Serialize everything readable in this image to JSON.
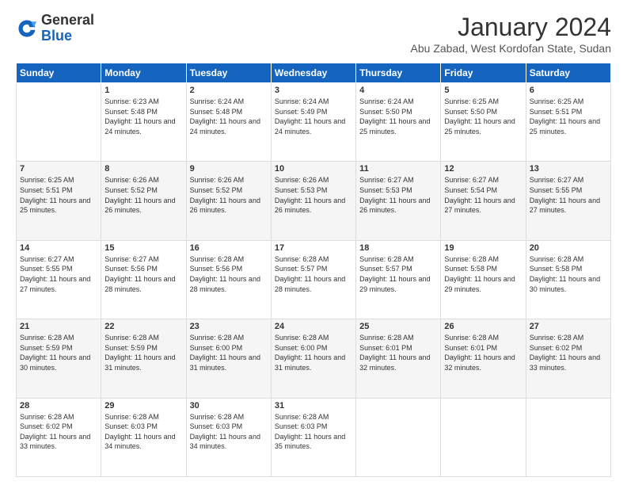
{
  "logo": {
    "general": "General",
    "blue": "Blue"
  },
  "header": {
    "month": "January 2024",
    "location": "Abu Zabad, West Kordofan State, Sudan"
  },
  "weekdays": [
    "Sunday",
    "Monday",
    "Tuesday",
    "Wednesday",
    "Thursday",
    "Friday",
    "Saturday"
  ],
  "weeks": [
    [
      {
        "day": "",
        "sunrise": "",
        "sunset": "",
        "daylight": ""
      },
      {
        "day": "1",
        "sunrise": "Sunrise: 6:23 AM",
        "sunset": "Sunset: 5:48 PM",
        "daylight": "Daylight: 11 hours and 24 minutes."
      },
      {
        "day": "2",
        "sunrise": "Sunrise: 6:24 AM",
        "sunset": "Sunset: 5:48 PM",
        "daylight": "Daylight: 11 hours and 24 minutes."
      },
      {
        "day": "3",
        "sunrise": "Sunrise: 6:24 AM",
        "sunset": "Sunset: 5:49 PM",
        "daylight": "Daylight: 11 hours and 24 minutes."
      },
      {
        "day": "4",
        "sunrise": "Sunrise: 6:24 AM",
        "sunset": "Sunset: 5:50 PM",
        "daylight": "Daylight: 11 hours and 25 minutes."
      },
      {
        "day": "5",
        "sunrise": "Sunrise: 6:25 AM",
        "sunset": "Sunset: 5:50 PM",
        "daylight": "Daylight: 11 hours and 25 minutes."
      },
      {
        "day": "6",
        "sunrise": "Sunrise: 6:25 AM",
        "sunset": "Sunset: 5:51 PM",
        "daylight": "Daylight: 11 hours and 25 minutes."
      }
    ],
    [
      {
        "day": "7",
        "sunrise": "Sunrise: 6:25 AM",
        "sunset": "Sunset: 5:51 PM",
        "daylight": "Daylight: 11 hours and 25 minutes."
      },
      {
        "day": "8",
        "sunrise": "Sunrise: 6:26 AM",
        "sunset": "Sunset: 5:52 PM",
        "daylight": "Daylight: 11 hours and 26 minutes."
      },
      {
        "day": "9",
        "sunrise": "Sunrise: 6:26 AM",
        "sunset": "Sunset: 5:52 PM",
        "daylight": "Daylight: 11 hours and 26 minutes."
      },
      {
        "day": "10",
        "sunrise": "Sunrise: 6:26 AM",
        "sunset": "Sunset: 5:53 PM",
        "daylight": "Daylight: 11 hours and 26 minutes."
      },
      {
        "day": "11",
        "sunrise": "Sunrise: 6:27 AM",
        "sunset": "Sunset: 5:53 PM",
        "daylight": "Daylight: 11 hours and 26 minutes."
      },
      {
        "day": "12",
        "sunrise": "Sunrise: 6:27 AM",
        "sunset": "Sunset: 5:54 PM",
        "daylight": "Daylight: 11 hours and 27 minutes."
      },
      {
        "day": "13",
        "sunrise": "Sunrise: 6:27 AM",
        "sunset": "Sunset: 5:55 PM",
        "daylight": "Daylight: 11 hours and 27 minutes."
      }
    ],
    [
      {
        "day": "14",
        "sunrise": "Sunrise: 6:27 AM",
        "sunset": "Sunset: 5:55 PM",
        "daylight": "Daylight: 11 hours and 27 minutes."
      },
      {
        "day": "15",
        "sunrise": "Sunrise: 6:27 AM",
        "sunset": "Sunset: 5:56 PM",
        "daylight": "Daylight: 11 hours and 28 minutes."
      },
      {
        "day": "16",
        "sunrise": "Sunrise: 6:28 AM",
        "sunset": "Sunset: 5:56 PM",
        "daylight": "Daylight: 11 hours and 28 minutes."
      },
      {
        "day": "17",
        "sunrise": "Sunrise: 6:28 AM",
        "sunset": "Sunset: 5:57 PM",
        "daylight": "Daylight: 11 hours and 28 minutes."
      },
      {
        "day": "18",
        "sunrise": "Sunrise: 6:28 AM",
        "sunset": "Sunset: 5:57 PM",
        "daylight": "Daylight: 11 hours and 29 minutes."
      },
      {
        "day": "19",
        "sunrise": "Sunrise: 6:28 AM",
        "sunset": "Sunset: 5:58 PM",
        "daylight": "Daylight: 11 hours and 29 minutes."
      },
      {
        "day": "20",
        "sunrise": "Sunrise: 6:28 AM",
        "sunset": "Sunset: 5:58 PM",
        "daylight": "Daylight: 11 hours and 30 minutes."
      }
    ],
    [
      {
        "day": "21",
        "sunrise": "Sunrise: 6:28 AM",
        "sunset": "Sunset: 5:59 PM",
        "daylight": "Daylight: 11 hours and 30 minutes."
      },
      {
        "day": "22",
        "sunrise": "Sunrise: 6:28 AM",
        "sunset": "Sunset: 5:59 PM",
        "daylight": "Daylight: 11 hours and 31 minutes."
      },
      {
        "day": "23",
        "sunrise": "Sunrise: 6:28 AM",
        "sunset": "Sunset: 6:00 PM",
        "daylight": "Daylight: 11 hours and 31 minutes."
      },
      {
        "day": "24",
        "sunrise": "Sunrise: 6:28 AM",
        "sunset": "Sunset: 6:00 PM",
        "daylight": "Daylight: 11 hours and 31 minutes."
      },
      {
        "day": "25",
        "sunrise": "Sunrise: 6:28 AM",
        "sunset": "Sunset: 6:01 PM",
        "daylight": "Daylight: 11 hours and 32 minutes."
      },
      {
        "day": "26",
        "sunrise": "Sunrise: 6:28 AM",
        "sunset": "Sunset: 6:01 PM",
        "daylight": "Daylight: 11 hours and 32 minutes."
      },
      {
        "day": "27",
        "sunrise": "Sunrise: 6:28 AM",
        "sunset": "Sunset: 6:02 PM",
        "daylight": "Daylight: 11 hours and 33 minutes."
      }
    ],
    [
      {
        "day": "28",
        "sunrise": "Sunrise: 6:28 AM",
        "sunset": "Sunset: 6:02 PM",
        "daylight": "Daylight: 11 hours and 33 minutes."
      },
      {
        "day": "29",
        "sunrise": "Sunrise: 6:28 AM",
        "sunset": "Sunset: 6:03 PM",
        "daylight": "Daylight: 11 hours and 34 minutes."
      },
      {
        "day": "30",
        "sunrise": "Sunrise: 6:28 AM",
        "sunset": "Sunset: 6:03 PM",
        "daylight": "Daylight: 11 hours and 34 minutes."
      },
      {
        "day": "31",
        "sunrise": "Sunrise: 6:28 AM",
        "sunset": "Sunset: 6:03 PM",
        "daylight": "Daylight: 11 hours and 35 minutes."
      },
      {
        "day": "",
        "sunrise": "",
        "sunset": "",
        "daylight": ""
      },
      {
        "day": "",
        "sunrise": "",
        "sunset": "",
        "daylight": ""
      },
      {
        "day": "",
        "sunrise": "",
        "sunset": "",
        "daylight": ""
      }
    ]
  ]
}
